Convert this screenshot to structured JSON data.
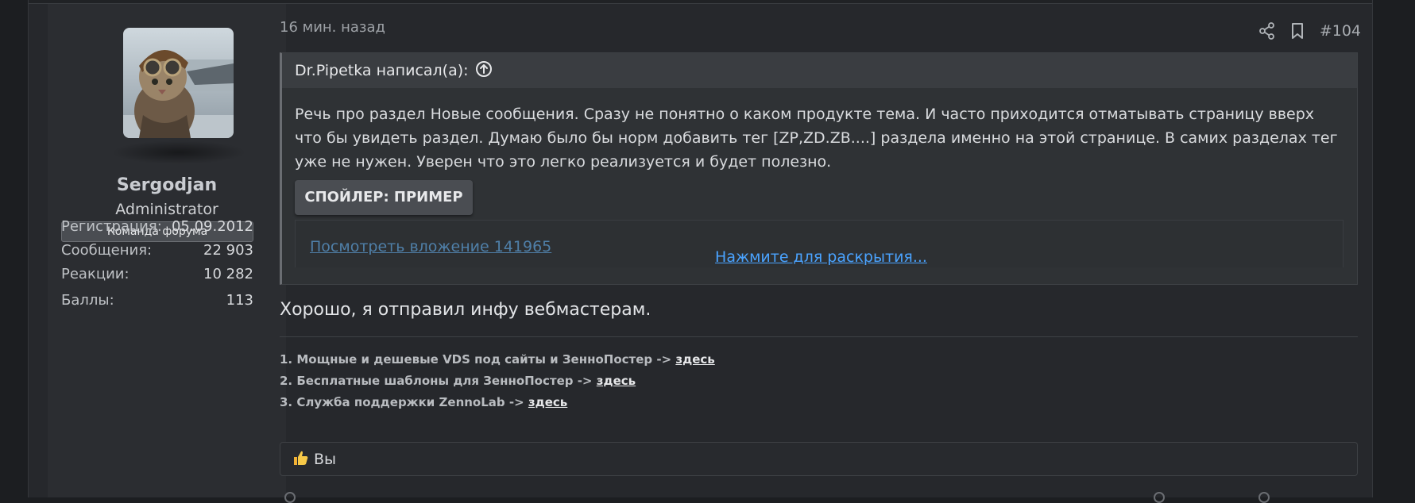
{
  "user": {
    "name": "Sergodjan",
    "title": "Administrator",
    "banner": "Команда форума",
    "stats": [
      {
        "label": "Регистрация:",
        "value": "05.09.2012"
      },
      {
        "label": "Сообщения:",
        "value": "22 903"
      },
      {
        "label": "Реакции:",
        "value": "10 282"
      },
      {
        "label": "Баллы:",
        "value": "113"
      }
    ]
  },
  "post": {
    "time": "16 мин. назад",
    "number": "#104",
    "quote": {
      "author": "Dr.Pipetka написал(а):",
      "text": "Речь про раздел Новые сообщения. Сразу не понятно о каком продукте тема. И часто приходится отматывать страницу вверх что бы увидеть раздел. Думаю было бы норм добавить тег [ZP,ZD.ZB....] раздела именно на этой странице. В самих разделах тег уже не нужен. Уверен что это легко реализуется и будет полезно.",
      "spoiler_label": "СПОЙЛЕР: ПРИМЕР",
      "attachment_label": "Посмотреть вложение 141965",
      "expand_label": "Нажмите для раскрытия..."
    },
    "reply": "Хорошо, я отправил инфу вебмастерам.",
    "signature": [
      {
        "text": "1. Мощные и дешевые VDS под сайты и ЗенноПостер -> ",
        "link": "здесь"
      },
      {
        "text": "2. Бесплатные шаблоны для ЗенноПостер -> ",
        "link": "здесь"
      },
      {
        "text": "3. Служба поддержки ZennoLab -> ",
        "link": "здесь"
      }
    ],
    "reaction_user": "Вы"
  },
  "colors": {
    "background": "#1c1e21",
    "post_bg": "#26282c",
    "link": "#4aa3ff"
  }
}
